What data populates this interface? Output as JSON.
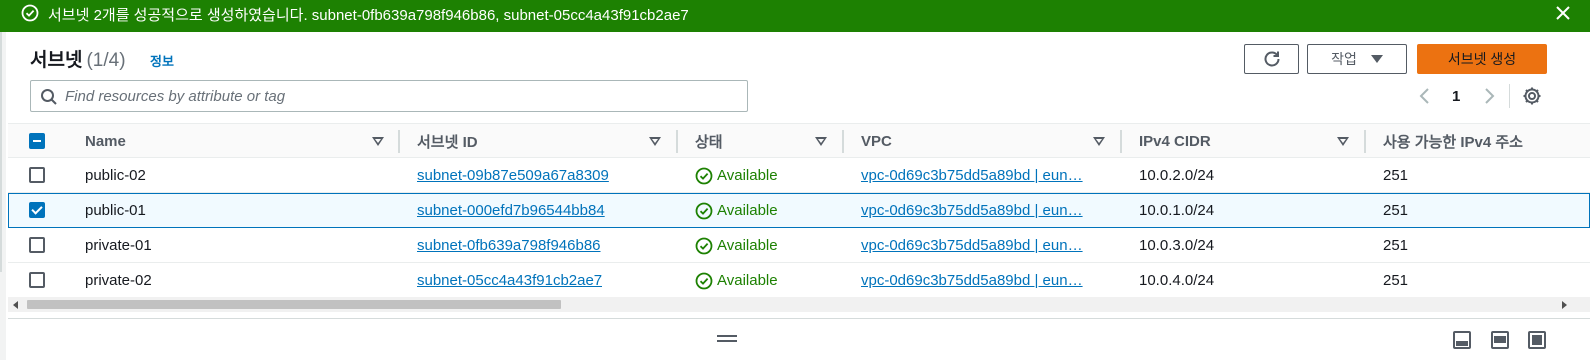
{
  "flash": {
    "message": "서브넷 2개를 성공적으로 생성하였습니다. subnet-0fb639a798f946b86, subnet-05cc4a43f91cb2ae7",
    "type": "success",
    "color": "#1d8102"
  },
  "header": {
    "title": "서브넷",
    "count": "(1/4)",
    "info_link": "정보",
    "actions_label": "작업",
    "create_label": "서브넷 생성"
  },
  "search": {
    "placeholder": "Find resources by attribute or tag",
    "value": ""
  },
  "pagination": {
    "current_page": "1"
  },
  "table": {
    "columns": [
      "Name",
      "서브넷 ID",
      "상태",
      "VPC",
      "IPv4 CIDR",
      "사용 가능한 IPv4 주소"
    ],
    "rows": [
      {
        "name": "public-02",
        "subnet_id": "subnet-09b87e509a67a8309",
        "status": "Available",
        "vpc": "vpc-0d69c3b75dd5a89bd | eun…",
        "cidr": "10.0.2.0/24",
        "available_ips": "251",
        "selected": false
      },
      {
        "name": "public-01",
        "subnet_id": "subnet-000efd7b96544bb84",
        "status": "Available",
        "vpc": "vpc-0d69c3b75dd5a89bd | eun…",
        "cidr": "10.0.1.0/24",
        "available_ips": "251",
        "selected": true
      },
      {
        "name": "private-01",
        "subnet_id": "subnet-0fb639a798f946b86",
        "status": "Available",
        "vpc": "vpc-0d69c3b75dd5a89bd | eun…",
        "cidr": "10.0.3.0/24",
        "available_ips": "251",
        "selected": false
      },
      {
        "name": "private-02",
        "subnet_id": "subnet-05cc4a43f91cb2ae7",
        "status": "Available",
        "vpc": "vpc-0d69c3b75dd5a89bd | eun…",
        "cidr": "10.0.4.0/24",
        "available_ips": "251",
        "selected": false
      }
    ]
  },
  "colors": {
    "accent": "#0073bb",
    "primary_button": "#ec7211",
    "success": "#1d8102"
  },
  "icons": [
    "check-circle-icon",
    "close-icon",
    "refresh-icon",
    "caret-down-icon",
    "search-icon",
    "chevron-left-icon",
    "chevron-right-icon",
    "gear-icon",
    "drag-handle-icon",
    "panel-bottom-icon",
    "panel-side-icon",
    "panel-hidden-icon"
  ]
}
